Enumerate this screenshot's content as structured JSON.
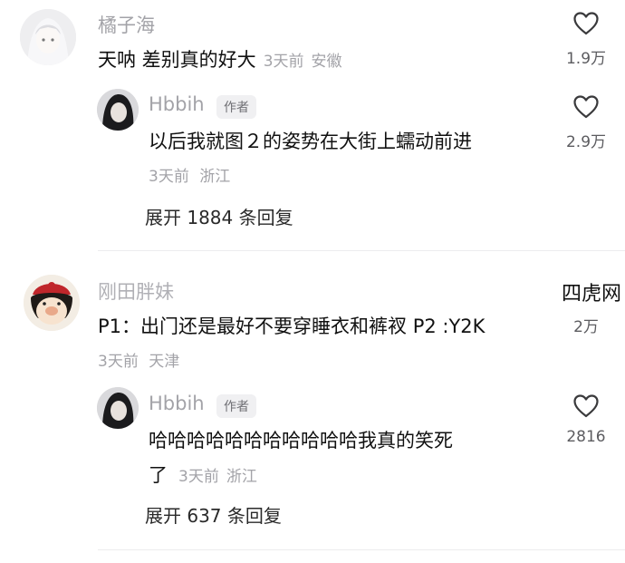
{
  "comments": [
    {
      "username": "橘子海",
      "content": "天呐 差别真的好大",
      "time": "3天前",
      "location": "安徽",
      "likes": "1.9万",
      "reply": {
        "username": "Hbbih",
        "tag": "作者",
        "content": "以后我就图２的姿势在大街上蠕动前进",
        "time": "3天前",
        "location": "浙江",
        "likes": "2.9万"
      },
      "expand_label": "展开 1884 条回复"
    },
    {
      "username": "刚田胖妹",
      "content": "P1：出门还是最好不要穿睡衣和裤衩 P2 :Y2K",
      "time": "3天前",
      "location": "天津",
      "likes": "2万",
      "reply": {
        "username": "Hbbih",
        "tag": "作者",
        "content_line1": "哈哈哈哈哈哈哈哈哈哈哈我真的笑死",
        "content_line2": "了",
        "time": "3天前",
        "location": "浙江",
        "likes": "2816"
      },
      "expand_label": "展开 637 条回复"
    }
  ],
  "watermark": "四虎网",
  "colors": {
    "meta": "#a3a3a8",
    "text": "#111111",
    "tag_bg": "#f0f0f2"
  }
}
